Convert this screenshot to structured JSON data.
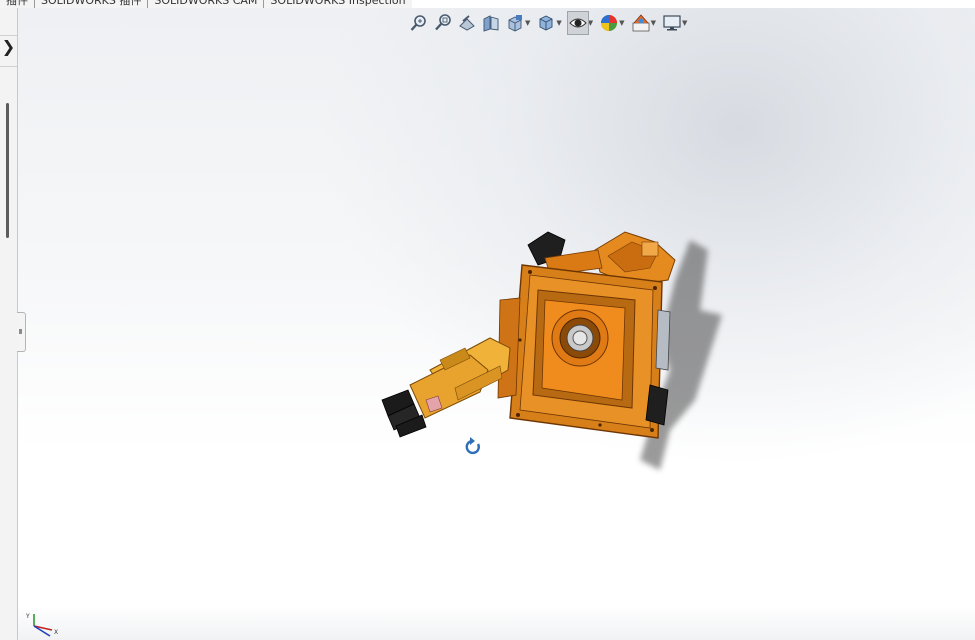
{
  "tabs": [
    {
      "label": "插件"
    },
    {
      "label": "SOLIDWORKS 插件"
    },
    {
      "label": "SOLIDWORKS CAM"
    },
    {
      "label": "SOLIDWORKS Inspection"
    }
  ],
  "left_panel": {
    "expand_glyph": "❯"
  },
  "hud_toolbar": {
    "items": [
      {
        "icon": "zoom-to-fit-icon"
      },
      {
        "icon": "zoom-to-area-icon"
      },
      {
        "icon": "previous-view-icon"
      },
      {
        "icon": "section-view-icon"
      },
      {
        "icon": "view-orientation-icon"
      },
      {
        "icon": "display-style-icon"
      },
      {
        "icon": "hide-show-items-icon"
      },
      {
        "icon": "edit-appearance-icon"
      },
      {
        "icon": "apply-scene-icon"
      },
      {
        "icon": "view-settings-icon"
      }
    ],
    "active": "hide-show-items-icon"
  },
  "triad": {
    "y_label": "Y",
    "x_label": "X"
  },
  "colors": {
    "model_orange": "#e8891e",
    "model_dark_orange": "#c96a10",
    "model_black": "#1c1c1c",
    "viewport_top": "#d7dbe1"
  }
}
